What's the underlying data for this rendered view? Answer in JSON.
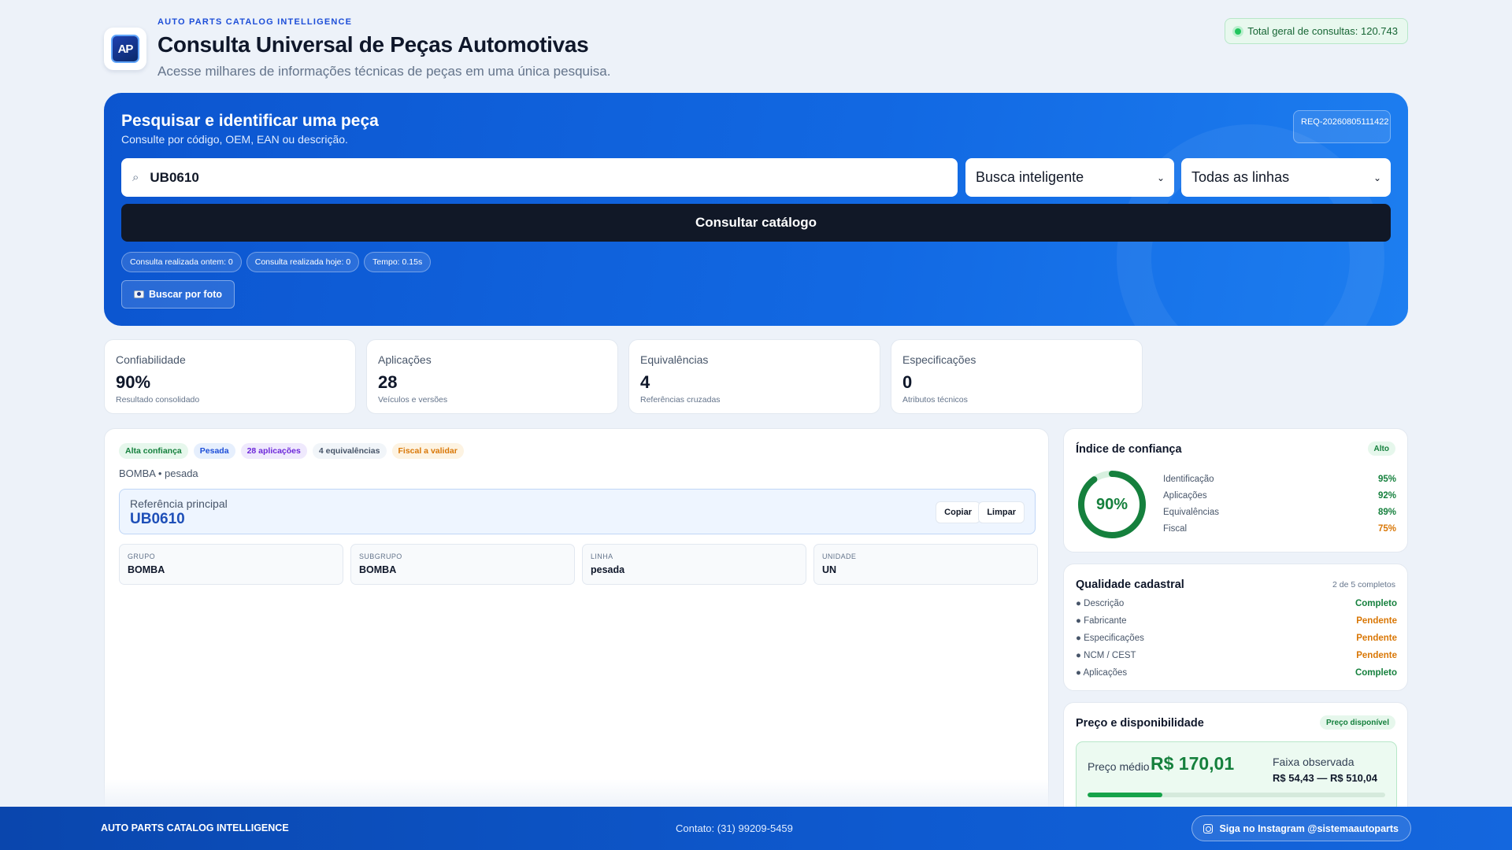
{
  "header": {
    "eyebrow": "AUTO PARTS CATALOG INTELLIGENCE",
    "title": "Consulta Universal de Peças Automotivas",
    "subtitle": "Acesse milhares de informações técnicas de peças em uma única pesquisa.",
    "logo_text": "AP",
    "total_badge": "Total geral de consultas: 120.743"
  },
  "search": {
    "title": "Pesquisar e identificar uma peça",
    "subtitle": "Consulte por código, OEM, EAN ou descrição.",
    "request_id": "REQ-20260805111422",
    "query": "UB0610",
    "mode": "Busca inteligente",
    "line": "Todas as linhas",
    "submit_label": "Consultar catálogo",
    "chips": [
      "Consulta realizada ontem: 0",
      "Consulta realizada hoje: 0",
      "Tempo: 0.15s"
    ],
    "photo_label": "Buscar por foto"
  },
  "stats": [
    {
      "label": "Confiabilidade",
      "value": "90%",
      "sub": "Resultado consolidado"
    },
    {
      "label": "Aplicações",
      "value": "28",
      "sub": "Veículos e versões"
    },
    {
      "label": "Equivalências",
      "value": "4",
      "sub": "Referências cruzadas"
    },
    {
      "label": "Especificações",
      "value": "0",
      "sub": "Atributos técnicos"
    }
  ],
  "result": {
    "tags": [
      "Alta confiança",
      "Pesada",
      "28 aplicações",
      "4 equivalências",
      "Fiscal a validar"
    ],
    "breadcrumb": "BOMBA • pesada",
    "reference_label": "Referência principal",
    "reference_value": "UB0610",
    "copy_label": "Copiar",
    "clear_label": "Limpar",
    "fields": [
      {
        "key": "GRUPO",
        "value": "BOMBA"
      },
      {
        "key": "SUBGRUPO",
        "value": "BOMBA"
      },
      {
        "key": "LINHA",
        "value": "pesada"
      },
      {
        "key": "UNIDADE",
        "value": "UN"
      }
    ]
  },
  "confidence": {
    "title": "Índice de confiança",
    "level": "Alto",
    "score": "90%",
    "score_fraction": 0.9,
    "metrics": [
      {
        "name": "Identificação",
        "value": "95%",
        "color": "#15803d"
      },
      {
        "name": "Aplicações",
        "value": "92%",
        "color": "#15803d"
      },
      {
        "name": "Equivalências",
        "value": "89%",
        "color": "#15803d"
      },
      {
        "name": "Fiscal",
        "value": "75%",
        "color": "#d97706"
      }
    ]
  },
  "quality": {
    "title": "Qualidade cadastral",
    "summary": "2 de 5 completos",
    "items": [
      {
        "name": "● Descrição",
        "status": "Completo",
        "color": "#15803d"
      },
      {
        "name": "● Fabricante",
        "status": "Pendente",
        "color": "#d97706"
      },
      {
        "name": "● Especificações",
        "status": "Pendente",
        "color": "#d97706"
      },
      {
        "name": "● NCM / CEST",
        "status": "Pendente",
        "color": "#d97706"
      },
      {
        "name": "● Aplicações",
        "status": "Completo",
        "color": "#15803d"
      }
    ]
  },
  "price": {
    "title": "Preço e disponibilidade",
    "badge": "Preço disponível",
    "avg_label": "Preço médio",
    "avg_value": "R$ 170,01",
    "range_label": "Faixa observada",
    "range_value": "R$ 54,43 — R$ 510,04",
    "bar_fraction": 0.25
  },
  "footer": {
    "brand": "AUTO PARTS CATALOG INTELLIGENCE",
    "contact": "Contato: (31) 99209-5459",
    "instagram": "Siga no Instagram @sistemaautoparts"
  },
  "colors": {
    "accent": "#1269e3",
    "dark": "#111827",
    "success": "#15803d",
    "warning": "#d97706"
  }
}
